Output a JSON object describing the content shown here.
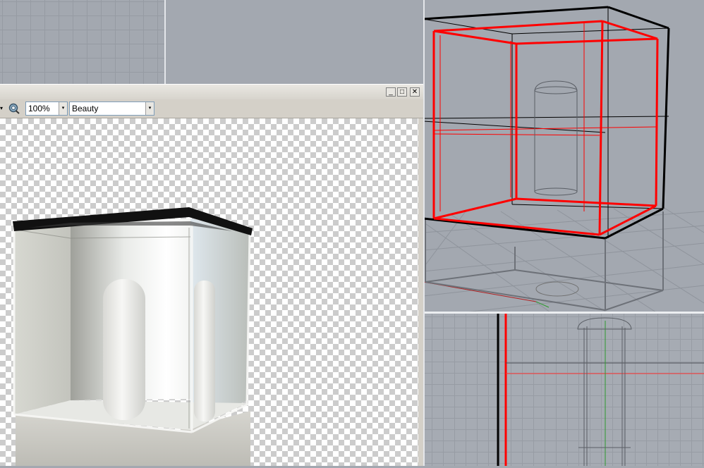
{
  "render_window": {
    "toolbar": {
      "zoom_value": "100%",
      "channel_value": "Beauty",
      "dropdown_arrow": "▾"
    },
    "window_buttons": {
      "minimize": "_",
      "maximize": "□",
      "close": "✕"
    }
  },
  "colors": {
    "viewport_bg": "#a3a8b0",
    "selection": "#ff0000",
    "wireframe": "#000000",
    "window_chrome": "#d4d0c8"
  }
}
